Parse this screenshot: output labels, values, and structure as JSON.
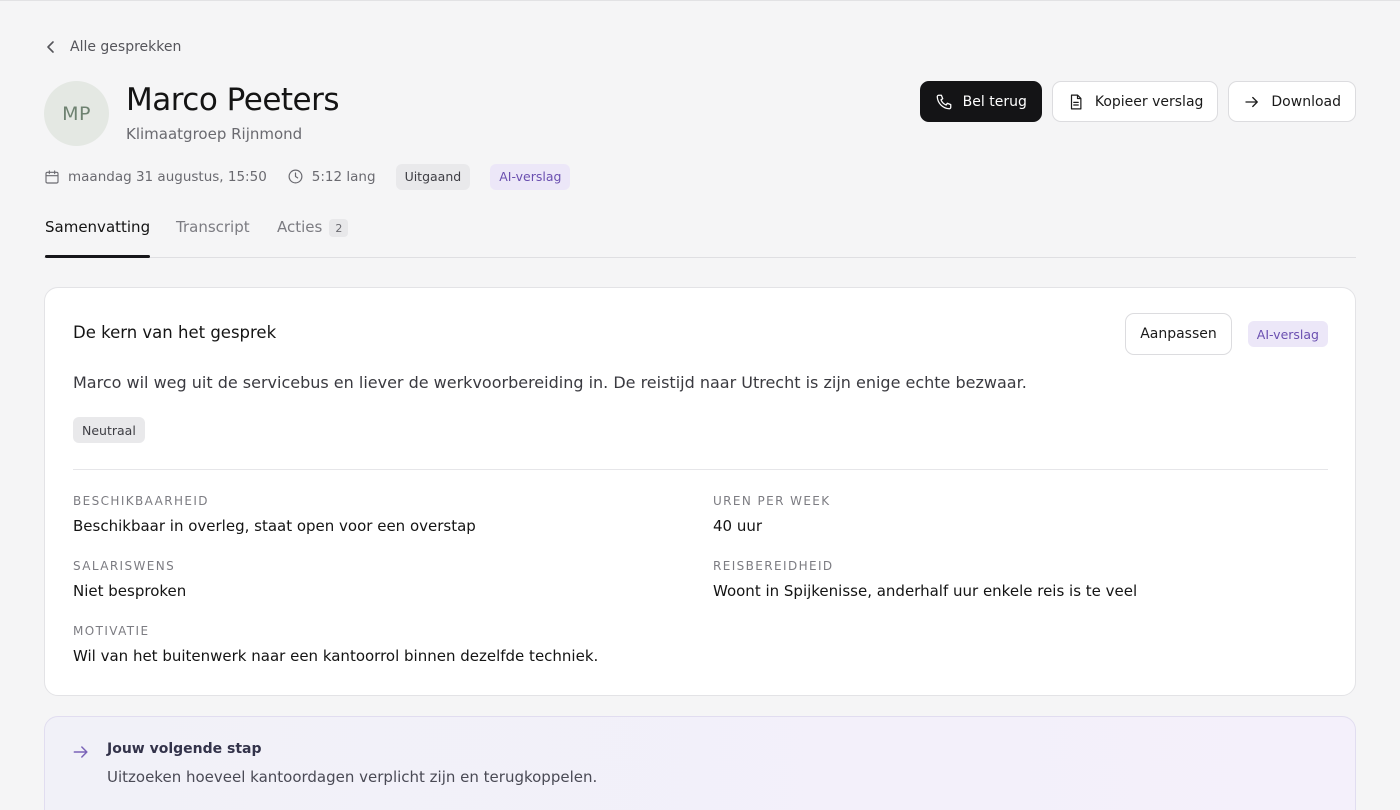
{
  "nav": {
    "back_label": "Alle gesprekken"
  },
  "contact": {
    "initials": "MP",
    "name": "Marco Peeters",
    "organization": "Klimaatgroep Rijnmond"
  },
  "actions": {
    "call_back": "Bel terug",
    "copy_report": "Kopieer verslag",
    "download": "Download"
  },
  "meta": {
    "date": "maandag 31 augustus, 15:50",
    "duration": "5:12 lang",
    "direction": "Uitgaand",
    "report_type": "AI-verslag"
  },
  "tabs": [
    {
      "label": "Samenvatting",
      "active": true
    },
    {
      "label": "Transcript",
      "active": false
    },
    {
      "label": "Acties",
      "count": "2",
      "active": false
    }
  ],
  "summary_card": {
    "title": "De kern van het gesprek",
    "edit_label": "Aanpassen",
    "badge": "AI-verslag",
    "text": "Marco wil weg uit de servicebus en liever de werkvoorbereiding in. De reistijd naar Utrecht is zijn enige echte bezwaar.",
    "sentiment": "Neutraal",
    "facts": [
      {
        "label": "Beschikbaarheid",
        "value": "Beschikbaar in overleg, staat open voor een overstap"
      },
      {
        "label": "Uren per week",
        "value": "40 uur"
      },
      {
        "label": "Salariswens",
        "value": "Niet besproken"
      },
      {
        "label": "Reisbereidheid",
        "value": "Woont in Spijkenisse, anderhalf uur enkele reis is te veel"
      },
      {
        "label": "Motivatie",
        "value": "Wil van het buitenwerk naar een kantoorrol binnen dezelfde techniek."
      }
    ]
  },
  "next_step": {
    "title": "Jouw volgende stap",
    "text": "Uitzoeken hoeveel kantoordagen verplicht zijn en terugkoppelen."
  },
  "colors": {
    "primary_button": "#141416",
    "accent_purple": "#6a4fb0",
    "background": "#f5f5f6"
  }
}
